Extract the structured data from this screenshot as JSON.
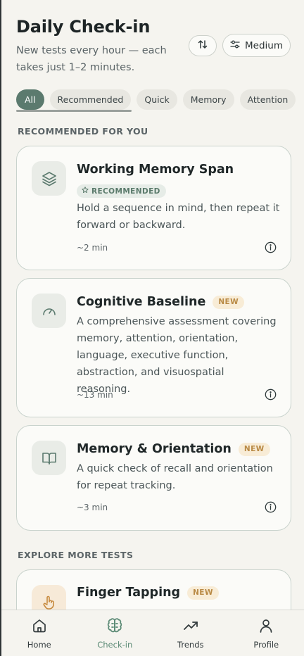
{
  "header": {
    "title": "Daily Check-in",
    "subtitle": "New tests every hour — each takes just 1–2 minutes.",
    "level_label": "Medium"
  },
  "filters": {
    "chips": [
      {
        "label": "All",
        "active": true
      },
      {
        "label": "Recommended",
        "active": false
      },
      {
        "label": "Quick",
        "active": false
      },
      {
        "label": "Memory",
        "active": false
      },
      {
        "label": "Attention",
        "active": false
      }
    ]
  },
  "sections": {
    "recommended": "RECOMMENDED FOR YOU",
    "explore": "EXPLORE MORE TESTS"
  },
  "cards": [
    {
      "title": "Working Memory Span",
      "badge": "RECOMMENDED",
      "description": "Hold a sequence in mind, then repeat it forward or backward.",
      "duration": "~2 min",
      "icon": "layers-icon"
    },
    {
      "title": "Cognitive Baseline",
      "badge": "NEW",
      "description": "A comprehensive assessment covering memory, attention, orientation, language, executive function, abstraction, and visuospatial reasoning.",
      "duration": "~13 min",
      "icon": "gauge-icon"
    },
    {
      "title": "Memory & Orientation",
      "badge": "NEW",
      "description": "A quick check of recall and orientation for repeat tracking.",
      "duration": "~3 min",
      "icon": "book-icon"
    },
    {
      "title": "Finger Tapping",
      "badge": "NEW",
      "icon": "hand-pointer-icon"
    }
  ],
  "nav": [
    {
      "label": "Home",
      "icon": "home-icon",
      "active": false
    },
    {
      "label": "Check-in",
      "icon": "brain-icon",
      "active": true
    },
    {
      "label": "Trends",
      "icon": "trend-icon",
      "active": false
    },
    {
      "label": "Profile",
      "icon": "user-icon",
      "active": false
    }
  ],
  "colors": {
    "accent": "#5b7a6e",
    "new_badge": "#b98a45",
    "background": "#f5f4ef"
  }
}
